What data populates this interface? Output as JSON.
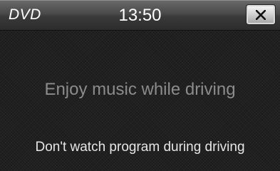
{
  "header": {
    "source": "DVD",
    "time": "13:50",
    "close_icon": "close-icon"
  },
  "message": {
    "primary": "Enjoy music while driving",
    "warning": "Don't watch program during driving"
  },
  "colors": {
    "primary_text": "#8c8c8c",
    "warning_text": "#e6e6e6",
    "background": "#1b1b1b"
  }
}
